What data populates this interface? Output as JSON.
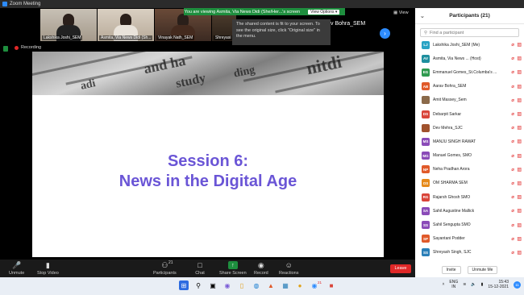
{
  "window": {
    "title": "Zoom Meeting"
  },
  "banner": {
    "text": "You are viewing Asmita, Via News Didi (She/Her...'s screen",
    "options": "View Options ▾"
  },
  "thumbnails": [
    {
      "label": "Lakshika Joshi_SEM"
    },
    {
      "label": "Asmita, Via News Didi (Sh..."
    },
    {
      "label": "Vinayak Nath_SEM"
    },
    {
      "label": "Shreyasi"
    }
  ],
  "tooltip": {
    "text": "The shared content is fit to your screen. To see the original size, click \"Original size\" in the menu."
  },
  "speaker": {
    "label": "v Bohra_SEM"
  },
  "view_btn": {
    "label": "View"
  },
  "recording": {
    "label": "Recording"
  },
  "slide": {
    "title_line1": "Session 6:",
    "title_line2": "News in the Digital Age",
    "bg_words": [
      "and ha",
      "study",
      "ding",
      "nitdi",
      "adi"
    ]
  },
  "toolbar": {
    "unmute": "Unmute",
    "stop_video": "Stop Video",
    "participants": "Participants",
    "participants_count": "21",
    "chat": "Chat",
    "share_screen": "Share Screen",
    "record": "Record",
    "reactions": "Reactions",
    "leave": "Leave"
  },
  "panel": {
    "title": "Participants (21)",
    "search_placeholder": "Find a participant",
    "participants": [
      {
        "initials": "LJ",
        "name": "Lakshika Joshi_SEM (Me)",
        "color": "#2aa3c4"
      },
      {
        "initials": "AV",
        "name": "Asmita, Via News ... (Host)",
        "color": "#1f8f9e"
      },
      {
        "initials": "EG",
        "name": "Emmanuel Gomes_St.Columba's ...",
        "color": "#2f9a4f"
      },
      {
        "initials": "AB",
        "name": "Aarav Bohra_SEM",
        "color": "#e05a2a"
      },
      {
        "initials": "",
        "name": "Amit Massey_Sem",
        "color": "#8b6a4a"
      },
      {
        "initials": "DS",
        "name": "Debarpit Sarkar",
        "color": "#d9453a"
      },
      {
        "initials": "",
        "name": "Dev Mehra_SJC",
        "color": "#a0522d"
      },
      {
        "initials": "MS",
        "name": "MANJU SINGH RAWAT",
        "color": "#8a4bb8"
      },
      {
        "initials": "MG",
        "name": "Manuel Gomes, SMO",
        "color": "#8a4bb8"
      },
      {
        "initials": "NP",
        "name": "Neha Pradhan Arora",
        "color": "#e05a2a"
      },
      {
        "initials": "OS",
        "name": "OM SHARMA SEM",
        "color": "#e68a1a"
      },
      {
        "initials": "RG",
        "name": "Rajarsh Ghosh SMO",
        "color": "#d9453a"
      },
      {
        "initials": "SA",
        "name": "Sahil Augustine Mallick",
        "color": "#8a4bb8"
      },
      {
        "initials": "SS",
        "name": "Sahil Sengupta SMO",
        "color": "#8a4bb8"
      },
      {
        "initials": "SP",
        "name": "Sayantani Podder",
        "color": "#e05a2a"
      },
      {
        "initials": "SS",
        "name": "Shreyash Singh, SJC",
        "color": "#2a7fb8"
      }
    ],
    "invite": "Invite",
    "unmute_me": "Unmute Me"
  },
  "taskbar": {
    "lang": "ENG",
    "region": "IN",
    "time": "15:43",
    "date": "15-12-2021",
    "notifications": "11",
    "zoom_badge": "21"
  }
}
